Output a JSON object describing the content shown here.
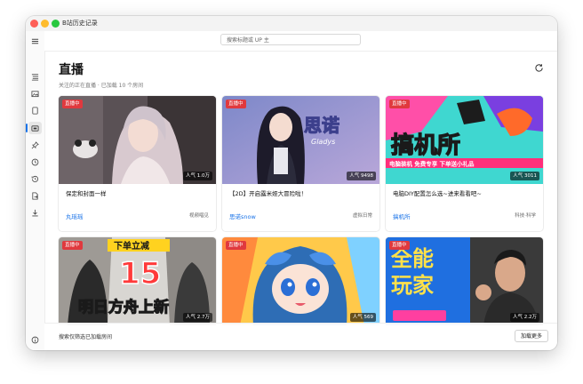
{
  "window": {
    "title": "B站历史记录"
  },
  "search": {
    "placeholder": "搜索标题或 UP 主"
  },
  "page": {
    "title": "直播",
    "subtitle": "关注的正在直播 · 已加载 10 个房间"
  },
  "cards": [
    {
      "badge": "直播中",
      "popularity": "人气 1.0万",
      "title": "保定和封面一样",
      "host": "丸瑶瑶",
      "category": "视频唱见"
    },
    {
      "badge": "直播中",
      "popularity": "人气 9498",
      "title": "【2D】开启露米娅大冒险啦！",
      "host": "思诺snow",
      "category": "虚拟日常"
    },
    {
      "badge": "直播中",
      "popularity": "人气 3011",
      "title": "电脑DIY配置怎么选~进来看看吧~",
      "host": "搞机所",
      "category": "科技·科学"
    },
    {
      "badge": "直播中",
      "popularity": "人气 2.7万",
      "title": "",
      "host": "",
      "category": "",
      "art_text": [
        "下单立减",
        "15",
        "明日方舟上新"
      ]
    },
    {
      "badge": "直播中",
      "popularity": "人气 569",
      "title": "",
      "host": "",
      "category": ""
    },
    {
      "badge": "直播中",
      "popularity": "人气 2.2万",
      "title": "",
      "host": "",
      "category": "",
      "art_text": [
        "全能",
        "玩家"
      ]
    }
  ],
  "card_art_text": {
    "card2": [
      "思诺",
      "Gladys"
    ],
    "card3": [
      "搞机所",
      "电脑装机 免费专享 下单送小礼品"
    ]
  },
  "footer": {
    "note": "搜索仅筛选已加载房间",
    "load_more": "加载更多"
  },
  "sidebar": {
    "icons": [
      "menu-icon",
      "list-icon",
      "image-icon",
      "tablet-icon",
      "live-icon",
      "pin-icon",
      "clock-icon",
      "history-icon",
      "export-icon",
      "download-icon",
      "info-icon",
      "settings-icon"
    ],
    "active": "live-icon"
  },
  "colors": {
    "accent": "#1a73e8",
    "live_badge": "#e0393e"
  }
}
